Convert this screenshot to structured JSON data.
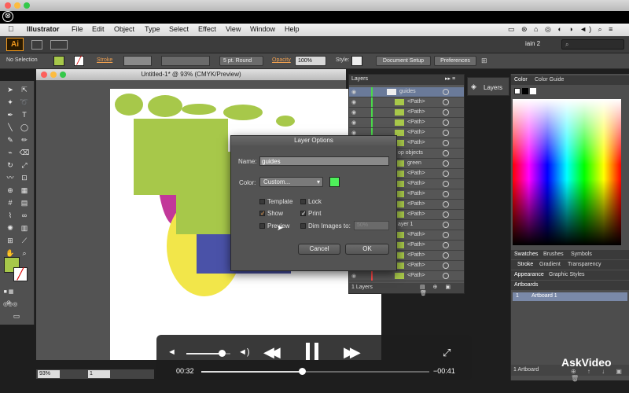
{
  "overlay": {
    "close_glyph": "⊗"
  },
  "menubar": {
    "items": [
      "Illustrator",
      "File",
      "Edit",
      "Object",
      "Type",
      "Select",
      "Effect",
      "View",
      "Window",
      "Help"
    ]
  },
  "appbar": {
    "logo": "Ai",
    "workspace": "iain 2",
    "search_icon": "⌕"
  },
  "control_bar": {
    "selection": "No Selection",
    "stroke_label": "Stroke",
    "brush": "5 pt. Round",
    "opacity_label": "Opacity",
    "opacity_value": "100%",
    "style_label": "Style:",
    "document_setup": "Document Setup",
    "preferences": "Preferences"
  },
  "document": {
    "title": "Untitled-1* @ 93% (CMYK/Preview)",
    "zoom": "93%",
    "page": "1"
  },
  "layers_panel": {
    "title": "Layers",
    "rows": [
      {
        "label": "guides",
        "stripe": "#4ad94a"
      },
      {
        "label": "<Path>",
        "stripe": "#4ad94a"
      },
      {
        "label": "<Path>",
        "stripe": "#4ad94a"
      },
      {
        "label": "<Path>",
        "stripe": "#4ad94a"
      },
      {
        "label": "<Path>",
        "stripe": "#4ad94a"
      },
      {
        "label": "<Path>",
        "stripe": "#4ad94a"
      },
      {
        "label": "op objects",
        "stripe": "#3a7bff"
      },
      {
        "label": "green",
        "stripe": "#3a7bff"
      },
      {
        "label": "<Path>",
        "stripe": "#3a7bff"
      },
      {
        "label": "<Path>",
        "stripe": "#3a7bff"
      },
      {
        "label": "<Path>",
        "stripe": "#3a7bff"
      },
      {
        "label": "<Path>",
        "stripe": "#3a7bff"
      },
      {
        "label": "<Path>",
        "stripe": "#3a7bff"
      },
      {
        "label": "ayer 1",
        "stripe": "#ff4b4b"
      },
      {
        "label": "<Path>",
        "stripe": "#ff4b4b"
      },
      {
        "label": "<Path>",
        "stripe": "#ff4b4b"
      },
      {
        "label": "<Path>",
        "stripe": "#ff4b4b"
      },
      {
        "label": "<Path>",
        "stripe": "#ff4b4b"
      },
      {
        "label": "<Path>",
        "stripe": "#ff4b4b"
      }
    ],
    "footer": "1 Layers"
  },
  "layers_button": {
    "label": "Layers"
  },
  "right_panel": {
    "color_tabs": [
      "Color",
      "Color Guide"
    ],
    "swatch_tabs": [
      "Swatches",
      "Brushes",
      "Symbols"
    ],
    "stroke_tabs": [
      "Stroke",
      "Gradient",
      "Transparency"
    ],
    "appearance_tabs": [
      "Appearance",
      "Graphic Styles"
    ],
    "artboards_title": "Artboards",
    "artboard_row": {
      "index": "1",
      "name": "Artboard 1"
    },
    "artboards_footer": "1 Artboard"
  },
  "dialog": {
    "title": "Layer Options",
    "name_label": "Name:",
    "name_value": "guides",
    "color_label": "Color:",
    "color_value": "Custom...",
    "color_swatch": "#4ef05a",
    "template": "Template",
    "lock": "Lock",
    "show": "Show",
    "print": "Print",
    "preview": "Preview",
    "dim": "Dim Images to:",
    "dim_value": "50%",
    "cancel": "Cancel",
    "ok": "OK",
    "show_checked": true,
    "print_checked": true
  },
  "player": {
    "elapsed": "00:32",
    "remaining": "−00:41",
    "progress": 0.44,
    "volume": 0.8
  },
  "branding": {
    "watermark": "AskVideo"
  },
  "colors": {
    "green": "#a7c84a",
    "magenta": "#c2389a",
    "yellow": "#f2e64a",
    "blue": "#4a52a8"
  }
}
